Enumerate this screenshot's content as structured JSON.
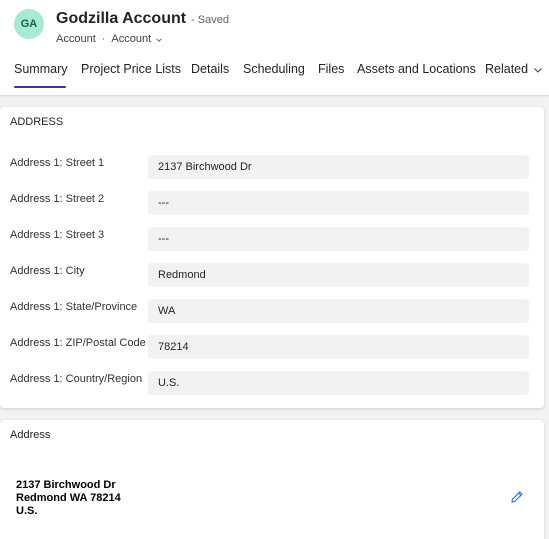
{
  "header": {
    "avatar_initials": "GA",
    "title": "Godzilla Account",
    "saved_status": "- Saved",
    "breadcrumb": {
      "entity": "Account",
      "separator": "·",
      "form": "Account"
    }
  },
  "tabs": [
    {
      "label": "Summary",
      "active": true
    },
    {
      "label": "Project Price Lists"
    },
    {
      "label": "Details"
    },
    {
      "label": "Scheduling"
    },
    {
      "label": "Files"
    },
    {
      "label": "Assets and Locations"
    },
    {
      "label": "Related"
    }
  ],
  "address_section": {
    "title": "ADDRESS",
    "fields": [
      {
        "label": "Address 1: Street 1",
        "value": "2137 Birchwood Dr"
      },
      {
        "label": "Address 1: Street 2",
        "value": "---"
      },
      {
        "label": "Address 1: Street 3",
        "value": "---"
      },
      {
        "label": "Address 1: City",
        "value": "Redmond"
      },
      {
        "label": "Address 1: State/Province",
        "value": "WA"
      },
      {
        "label": "Address 1: ZIP/Postal Code",
        "value": "78214"
      },
      {
        "label": "Address 1: Country/Region",
        "value": "U.S."
      }
    ]
  },
  "address_card": {
    "title": "Address",
    "lines": [
      "2137 Birchwood Dr",
      "Redmond WA 78214",
      "U.S."
    ]
  },
  "colors": {
    "accent": "#2f3a8f",
    "avatar_bg": "#a8ead1",
    "avatar_text": "#1e5e45",
    "edit_icon": "#2b6cd4",
    "field_bg": "#f3f2f1"
  },
  "icons": {
    "breadcrumb_chevron": "chevron-down-icon",
    "related_chevron": "chevron-down-icon",
    "edit": "pencil-icon"
  }
}
